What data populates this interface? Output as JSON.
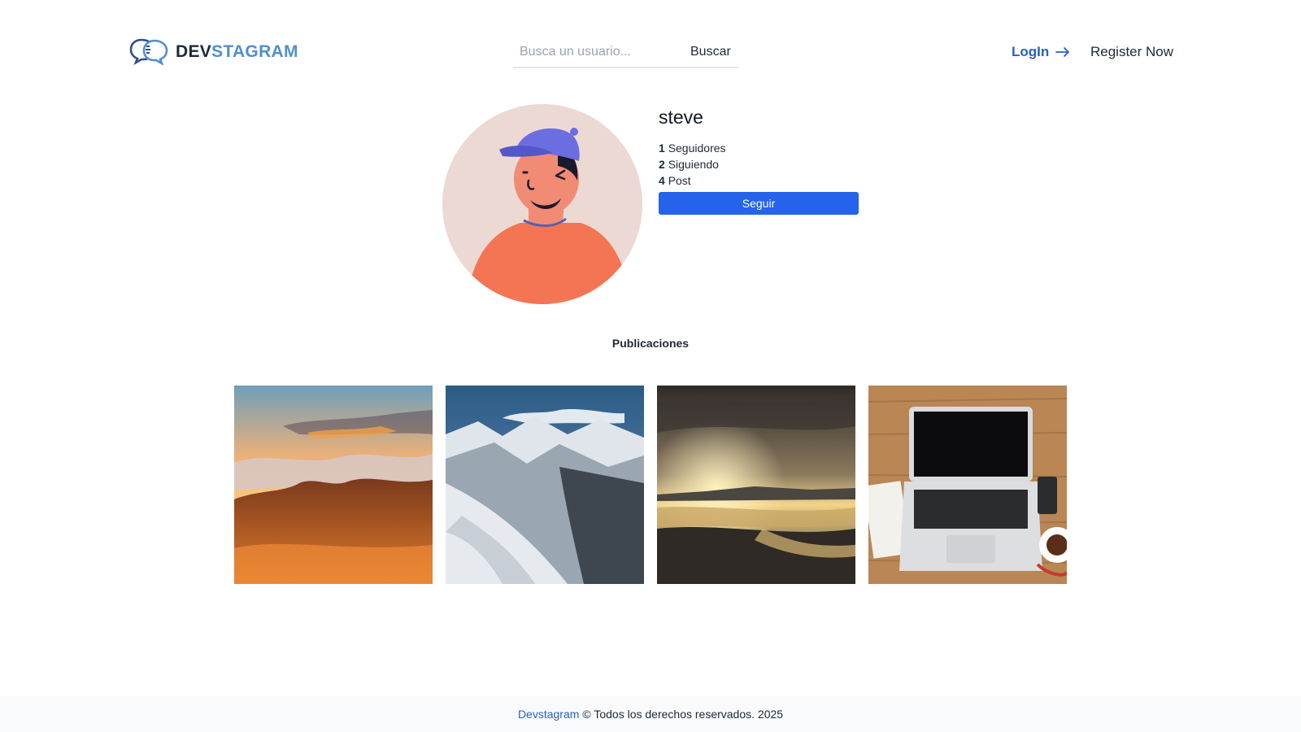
{
  "header": {
    "logo": {
      "part1": "DEV",
      "part2": "STAGRAM"
    },
    "search": {
      "placeholder": "Busca un usuario...",
      "value": "",
      "button_label": "Buscar"
    },
    "nav": {
      "login_label": "LogIn",
      "register_label": "Register Now"
    },
    "colors": {
      "brand_dark": "#1e293b",
      "brand_light": "#4f8fcc",
      "link": "#2b5fc4"
    }
  },
  "profile": {
    "username": "steve",
    "stats": [
      {
        "count": "1",
        "label": "Seguidores"
      },
      {
        "count": "2",
        "label": "Siguiendo"
      },
      {
        "count": "4",
        "label": "Post"
      }
    ],
    "follow_label": "Seguir",
    "avatar_icon": "cartoon-avatar-cap",
    "accent_color": "#2563eb"
  },
  "posts": {
    "heading": "Publicaciones",
    "items": [
      {
        "image": "sunset-mountains-clouds"
      },
      {
        "image": "snowy-mountain-valley"
      },
      {
        "image": "beach-sunset-people"
      },
      {
        "image": "laptop-on-wooden-desk"
      }
    ]
  },
  "footer": {
    "brand": "Devstagram",
    "text": "© Todos los derechos reservados. 2025"
  }
}
